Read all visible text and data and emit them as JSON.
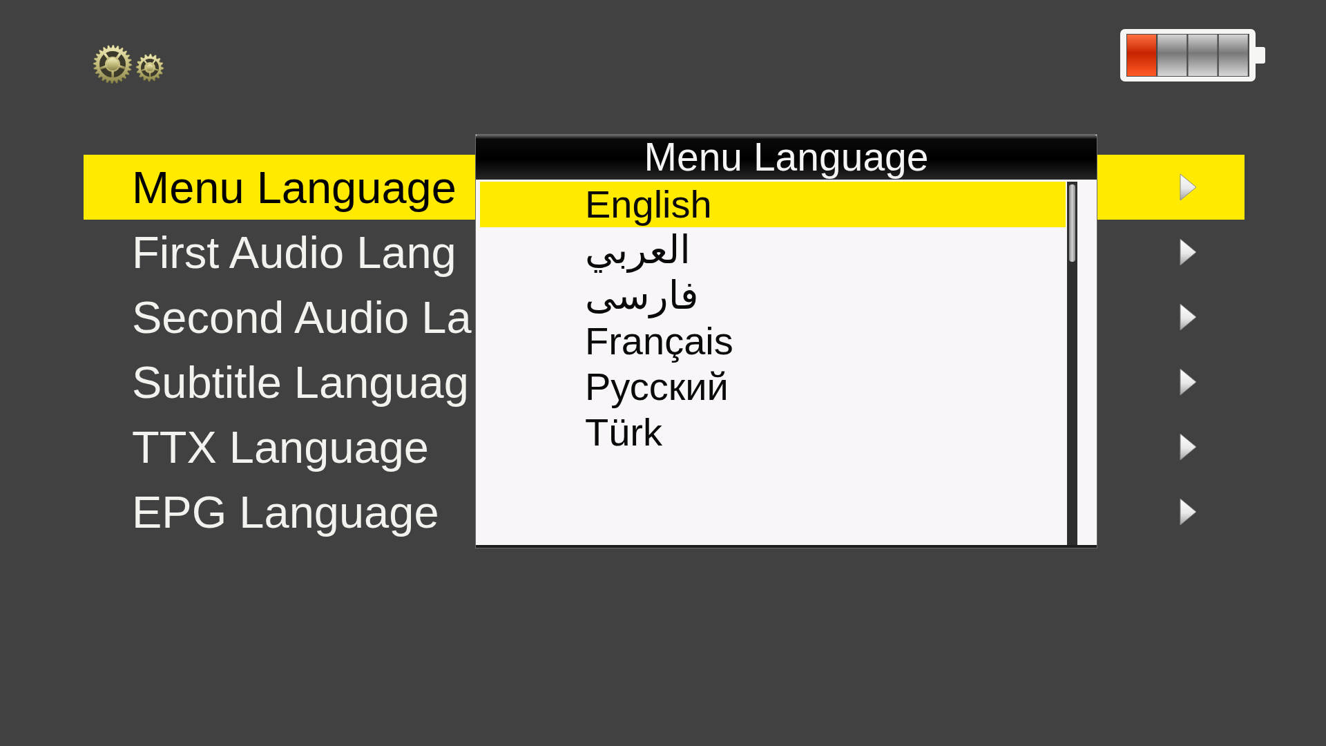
{
  "menu": {
    "items": [
      {
        "label": "Menu Language",
        "selected": true
      },
      {
        "label": "First Audio Lang",
        "selected": false
      },
      {
        "label": "Second Audio La",
        "selected": false
      },
      {
        "label": "Subtitle Languag",
        "selected": false
      },
      {
        "label": "TTX Language",
        "selected": false
      },
      {
        "label": "EPG Language",
        "selected": false
      }
    ]
  },
  "popup": {
    "title": "Menu Language",
    "options": [
      {
        "label": "English",
        "selected": true
      },
      {
        "label": "العربي",
        "selected": false
      },
      {
        "label": "فارسی",
        "selected": false
      },
      {
        "label": "Français",
        "selected": false
      },
      {
        "label": "Русский",
        "selected": false
      },
      {
        "label": "Türk",
        "selected": false
      }
    ]
  }
}
